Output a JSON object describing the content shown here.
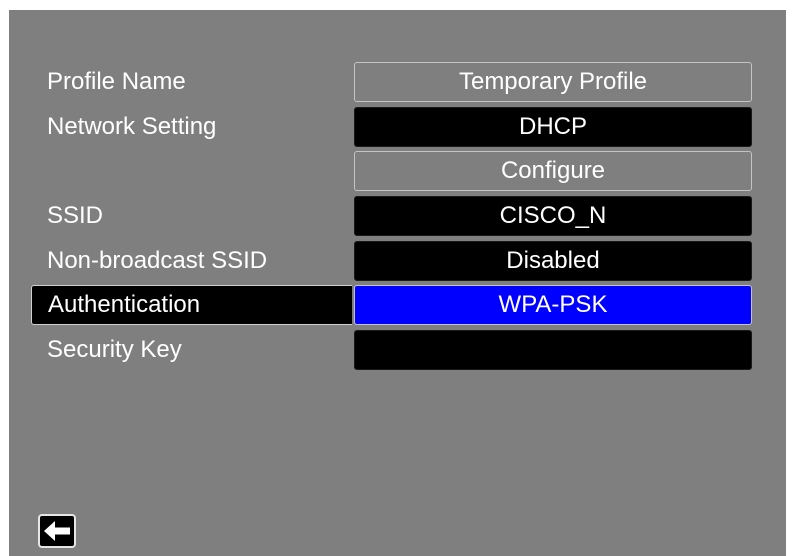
{
  "rows": [
    {
      "label": "Profile Name",
      "value": "Temporary Profile"
    },
    {
      "label": "Network Setting",
      "value": "DHCP"
    },
    {
      "label": "",
      "value": "Configure"
    },
    {
      "label": "SSID",
      "value": "CISCO_N"
    },
    {
      "label": "Non-broadcast SSID",
      "value": "Disabled"
    },
    {
      "label": "Authentication",
      "value": "WPA-PSK"
    },
    {
      "label": "Security Key",
      "value": ""
    }
  ],
  "selected_row": "Authentication",
  "icons": {
    "back": "left-arrow-icon"
  },
  "colors": {
    "background": "#7f7f7f",
    "field_dark": "#000000",
    "selection": "#0000ff",
    "text": "#ffffff"
  }
}
